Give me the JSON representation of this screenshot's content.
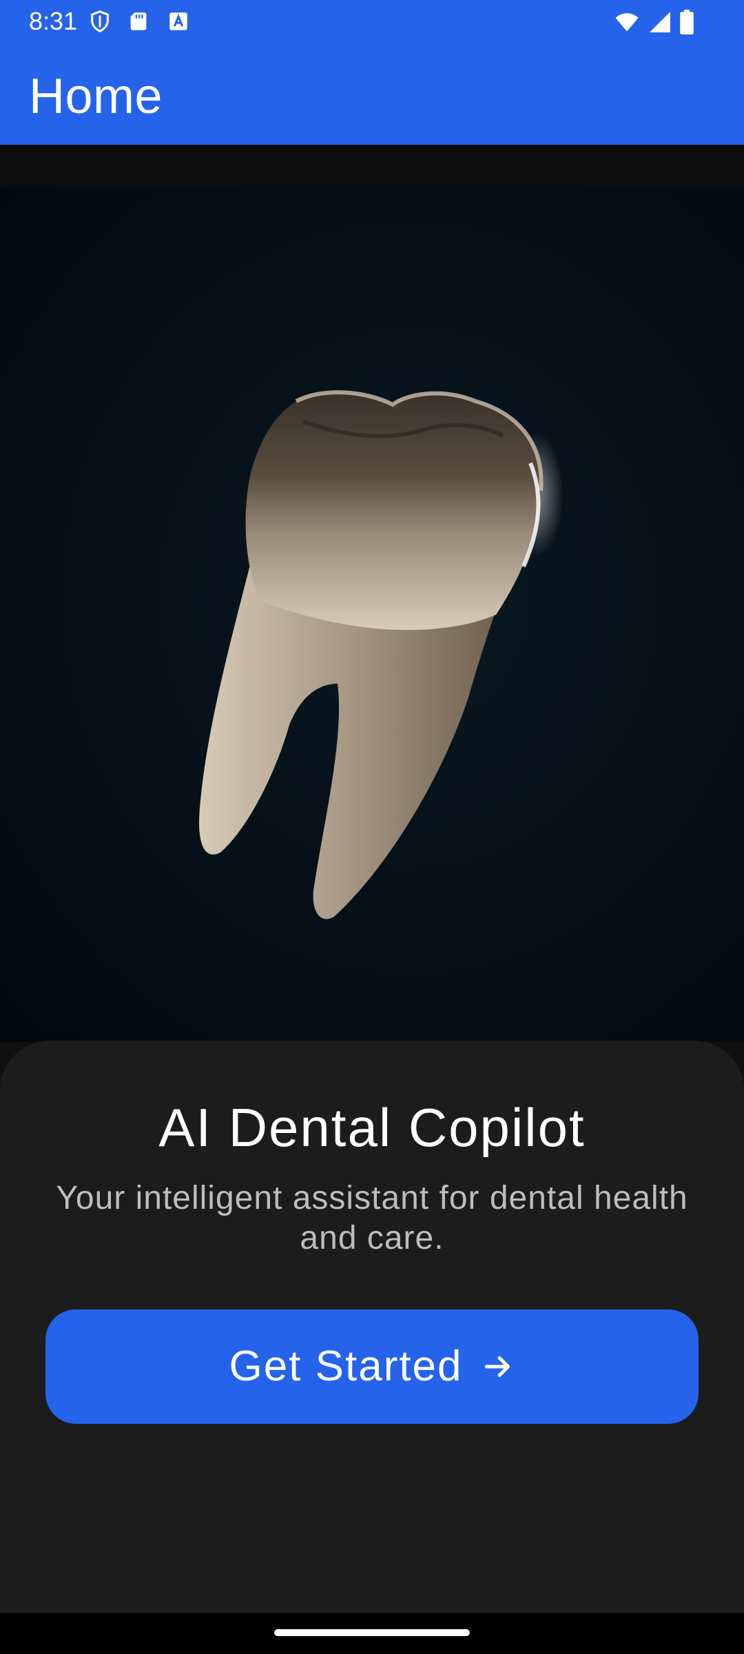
{
  "status_bar": {
    "time": "8:31",
    "left_icons": [
      "shield-icon",
      "sd-card-icon",
      "keyboard-a-icon"
    ],
    "right_icons": [
      "wifi-icon",
      "cell-signal-icon",
      "battery-icon"
    ]
  },
  "app_bar": {
    "title": "Home"
  },
  "hero": {
    "image": "molar-tooth-illustration"
  },
  "sheet": {
    "title": "AI Dental Copilot",
    "subtitle": "Your intelligent assistant for dental health and care.",
    "cta_label": "Get Started",
    "cta_icon": "arrow-right-icon"
  },
  "colors": {
    "primary": "#2563eb",
    "sheet_bg": "#1c1c1d",
    "hero_bg": "#020a10",
    "subtitle": "#bdbdbd"
  }
}
